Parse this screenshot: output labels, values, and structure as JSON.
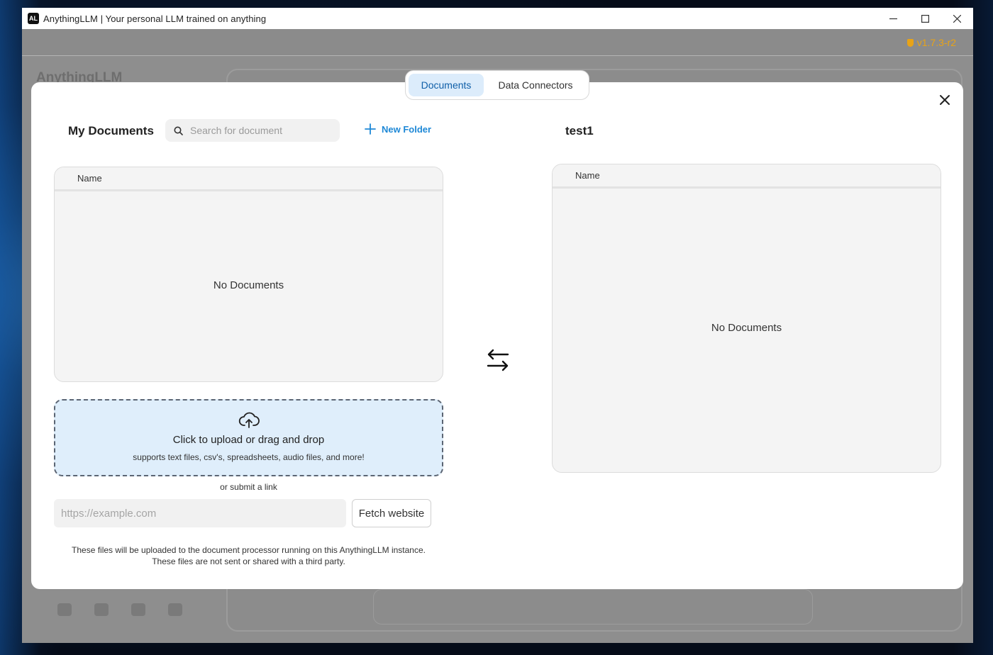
{
  "window": {
    "title": "AnythingLLM | Your personal LLM trained on anything",
    "logo_text": "AL"
  },
  "app": {
    "version": "v1.7.3-r2",
    "sidebar_logo_text": "AnythingLLM"
  },
  "modal": {
    "tabs": [
      {
        "label": "Documents",
        "active": true
      },
      {
        "label": "Data Connectors",
        "active": false
      }
    ],
    "my_documents": {
      "title": "My Documents",
      "search_placeholder": "Search for document",
      "new_folder_label": "New Folder",
      "column_name": "Name",
      "empty_text": "No Documents"
    },
    "workspace": {
      "title": "test1",
      "column_name": "Name",
      "empty_text": "No Documents"
    },
    "upload": {
      "title": "Click to upload or drag and drop",
      "subtitle": "supports text files, csv's, spreadsheets, audio files, and more!",
      "or_link": "or submit a link",
      "url_placeholder": "https://example.com",
      "fetch_label": "Fetch website"
    },
    "disclaimer": {
      "line1": "These files will be uploaded to the document processor running on this AnythingLLM instance.",
      "line2": "These files are not sent or shared with a third party."
    }
  },
  "colors": {
    "accent": "#1e88d6",
    "active_tab_bg": "#dcecfb",
    "version_color": "#e8a317",
    "upload_bg": "#dfeefb"
  },
  "icons": [
    "minimize-icon",
    "maximize-icon",
    "window-close-icon",
    "search-icon",
    "plus-icon",
    "modal-close-icon",
    "swap-arrows-icon",
    "cloud-upload-icon",
    "shield-icon"
  ]
}
